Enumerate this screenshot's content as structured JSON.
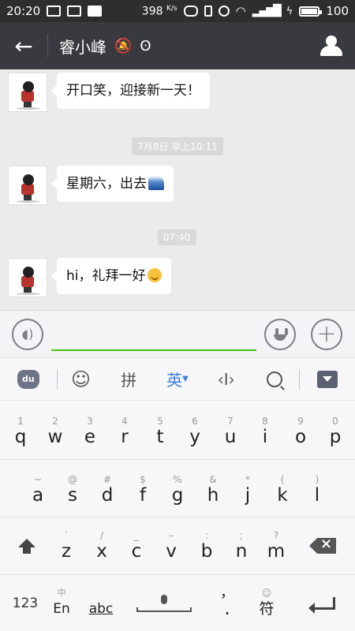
{
  "status_bar": {
    "time": "20:20",
    "net_speed": "398",
    "net_unit": "K/s",
    "battery": "100"
  },
  "title_bar": {
    "contact_name": "睿小峰"
  },
  "chat": {
    "messages": [
      {
        "text": "开口笑，迎接新一天！"
      },
      {
        "text": "星期六，出去"
      },
      {
        "text": "hi，礼拜一好"
      }
    ],
    "timestamps": [
      "7月8日 早上10:11",
      "07:40"
    ]
  },
  "keyboard_toolbar": {
    "logo": "du",
    "pinyin": "拼",
    "english": "英"
  },
  "keyboard": {
    "row1": [
      {
        "hint": "1",
        "key": "q"
      },
      {
        "hint": "2",
        "key": "w"
      },
      {
        "hint": "3",
        "key": "e"
      },
      {
        "hint": "4",
        "key": "r"
      },
      {
        "hint": "5",
        "key": "t"
      },
      {
        "hint": "6",
        "key": "y"
      },
      {
        "hint": "7",
        "key": "u"
      },
      {
        "hint": "8",
        "key": "i"
      },
      {
        "hint": "9",
        "key": "o"
      },
      {
        "hint": "0",
        "key": "p"
      }
    ],
    "row2": [
      {
        "hint": "~",
        "key": "a"
      },
      {
        "hint": "@",
        "key": "s"
      },
      {
        "hint": "#",
        "key": "d"
      },
      {
        "hint": "$",
        "key": "f"
      },
      {
        "hint": "%",
        "key": "g"
      },
      {
        "hint": "&",
        "key": "h"
      },
      {
        "hint": "*",
        "key": "j"
      },
      {
        "hint": "(",
        "key": "k"
      },
      {
        "hint": ")",
        "key": "l"
      }
    ],
    "row3": [
      {
        "hint": "′",
        "key": "z"
      },
      {
        "hint": "/",
        "key": "x"
      },
      {
        "hint": "_",
        "key": "c"
      },
      {
        "hint": "–",
        "key": "v"
      },
      {
        "hint": ":",
        "key": "b"
      },
      {
        "hint": ";",
        "key": "n"
      },
      {
        "hint": "?",
        "key": "m"
      }
    ],
    "bottom": {
      "numbers": "123",
      "lang_hint": "中",
      "lang": "En",
      "abc": "abc",
      "punct_hint": "，",
      "punct": ".",
      "symbols": "符",
      "symbols_hint": "☺"
    }
  }
}
